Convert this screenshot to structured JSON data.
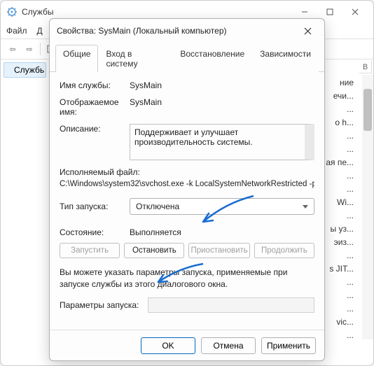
{
  "main": {
    "title": "Службы",
    "menu": {
      "file": "Файл",
      "action": "Д"
    },
    "sidebar_label": "Службь",
    "bg_col_header": "В",
    "bg_rows": [
      "ние",
      "ечи...",
      "...",
      "o h...",
      "...",
      "...",
      "ая пе...",
      "...",
      "...",
      "Wi...",
      "...",
      "ы уз...",
      "эиз...",
      "...",
      "s JIT...",
      "...",
      "...",
      "...",
      "vic...",
      "..."
    ]
  },
  "dialog": {
    "title": "Свойства: SysMain (Локальный компьютер)",
    "tabs": {
      "general": "Общие",
      "logon": "Вход в систему",
      "recovery": "Восстановление",
      "deps": "Зависимости"
    },
    "labels": {
      "service_name": "Имя службы:",
      "display_name": "Отображаемое имя:",
      "description": "Описание:",
      "exec": "Исполняемый файл:",
      "startup": "Тип запуска:",
      "status": "Состояние:",
      "params": "Параметры запуска:"
    },
    "values": {
      "service_name": "SysMain",
      "display_name": "SysMain",
      "description": "Поддерживает и улучшает производительность системы.",
      "exec_path": "C:\\Windows\\system32\\svchost.exe -k LocalSystemNetworkRestricted -p",
      "startup_selected": "Отключена",
      "status": "Выполняется"
    },
    "buttons": {
      "start": "Запустить",
      "stop": "Остановить",
      "pause": "Приостановить",
      "resume": "Продолжить"
    },
    "hint": "Вы можете указать параметры запуска, применяемые при запуске службы из этого диалогового окна.",
    "footer": {
      "ok": "OK",
      "cancel": "Отмена",
      "apply": "Применить"
    }
  }
}
